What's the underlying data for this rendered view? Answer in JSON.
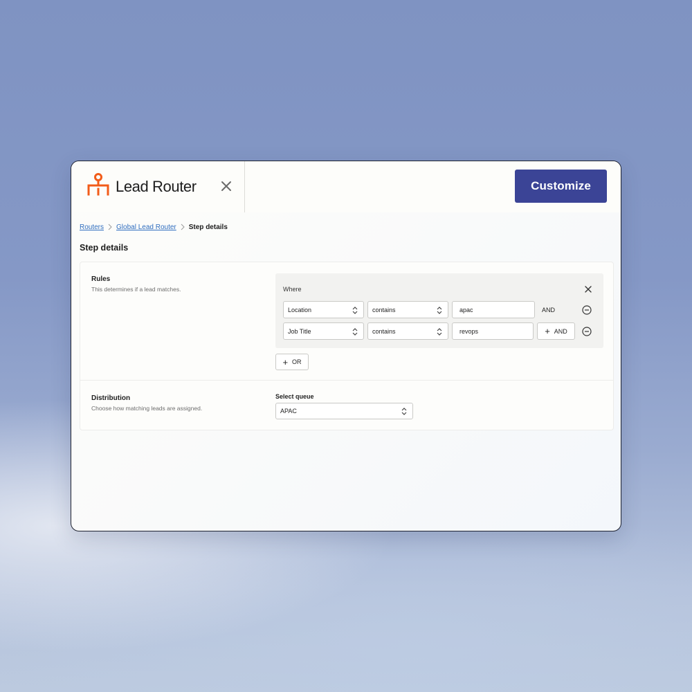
{
  "app": {
    "name": "Lead Router",
    "customize_label": "Customize",
    "brand_color": "#f25c19",
    "accent_color": "#3b4496"
  },
  "breadcrumb": {
    "items": [
      "Routers",
      "Global Lead Router"
    ],
    "current": "Step details"
  },
  "page": {
    "title": "Step details"
  },
  "rules": {
    "label": "Rules",
    "description": "This determines if a lead matches.",
    "where_label": "Where",
    "conditions": [
      {
        "field": "Location",
        "operator": "contains",
        "value": "apac",
        "conjunction": "AND"
      },
      {
        "field": "Job Title",
        "operator": "contains",
        "value": "revops",
        "add_and_label": "AND"
      }
    ],
    "or_label": "OR"
  },
  "distribution": {
    "label": "Distribution",
    "description": "Choose how matching leads are assigned.",
    "queue_label": "Select queue",
    "queue_value": "APAC"
  }
}
